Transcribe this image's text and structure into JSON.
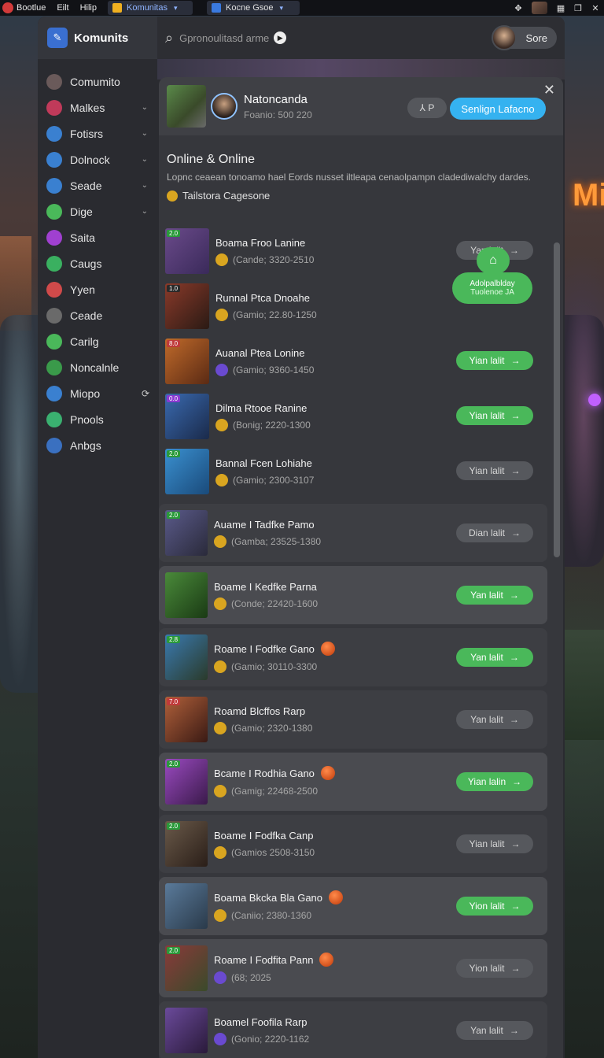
{
  "topbar": {
    "menu": [
      "Bootlue",
      "Eilt",
      "Hilip"
    ],
    "tabs": [
      {
        "label": "Komunitas",
        "color": "#f0b020"
      },
      {
        "label": "Kocne Gsoe",
        "color": "#3a7ae0"
      }
    ],
    "icons": [
      "move-icon",
      "avatar",
      "grid-icon",
      "window-icon",
      "close-icon"
    ]
  },
  "sidebar": {
    "title": "Komunits",
    "items": [
      {
        "label": "Comumito",
        "icon": "avatar-icon",
        "color": "#6a5a5a",
        "chevron": false
      },
      {
        "label": "Malkes",
        "icon": "gem-icon",
        "color": "#c03a5a",
        "chevron": true
      },
      {
        "label": "Fotisrs",
        "icon": "sword-icon",
        "color": "#3a80d0",
        "chevron": true
      },
      {
        "label": "Dolnock",
        "icon": "globe-icon",
        "color": "#3a80d0",
        "chevron": true
      },
      {
        "label": "Seade",
        "icon": "grid-icon",
        "color": "#3a80d0",
        "chevron": true
      },
      {
        "label": "Dige",
        "icon": "pen-icon",
        "color": "#4ab85a",
        "chevron": true
      },
      {
        "label": "Saita",
        "icon": "star-icon",
        "color": "#a040d0",
        "chevron": false
      },
      {
        "label": "Caugs",
        "icon": "search-icon",
        "color": "#3ab060",
        "chevron": false
      },
      {
        "label": "Yyen",
        "icon": "target-icon",
        "color": "#d04a4a",
        "chevron": false
      },
      {
        "label": "Ceade",
        "icon": "plus-icon",
        "color": "#6a6a6a",
        "chevron": false
      },
      {
        "label": "Carilg",
        "icon": "gear-icon",
        "color": "#4ab85a",
        "chevron": false
      },
      {
        "label": "Noncalnle",
        "icon": "leaf-icon",
        "color": "#3a9a4a",
        "chevron": false
      },
      {
        "label": "Miopo",
        "icon": "rocket-icon",
        "color": "#3a80d0",
        "chevron": false,
        "trail": "⟳"
      },
      {
        "label": "Pnools",
        "icon": "monitor-icon",
        "color": "#3ab070",
        "chevron": false
      },
      {
        "label": "Anbgs",
        "icon": "wrench-icon",
        "color": "#3a70c0",
        "chevron": false
      }
    ]
  },
  "search": {
    "placeholder": "Gpronoulitasd arme",
    "user_label": "Sore"
  },
  "game": {
    "title": "Natoncanda",
    "sub": "Foanio: 500 220",
    "tool_label": "⅄ P",
    "primary_label": "Senlign Lafacno"
  },
  "section": {
    "title": "Online & Online",
    "desc": "Lopnc ceaean tonoamo hael Eords nusset iltleapa cenaolpampn cladediwalchy dardes.",
    "tag": "Tailstora Cagesone"
  },
  "list_a": [
    {
      "badge": "2.0",
      "badge_color": "#2a9a3a",
      "art": [
        "#6a4a8a",
        "#3a2a5a"
      ],
      "name": "Boama Froo Lanine",
      "meta": "(Cande; 3320-2510",
      "meta_icon": "coin",
      "action": "Yan lalit",
      "green": false
    },
    {
      "badge": "1.0",
      "badge_color": "#2a2a2a",
      "art": [
        "#8a3a2a",
        "#2a1a14"
      ],
      "name": "Runnal Ptca Dnoahe",
      "meta": "(Gamio; 22.80-1250",
      "meta_icon": "coin",
      "action": "",
      "green": false
    },
    {
      "badge": "8.0",
      "badge_color": "#c03a3a",
      "art": [
        "#c06a2a",
        "#5a2a14"
      ],
      "name": "Auanal Ptea Lonine",
      "meta": "(Gamio; 9360-1450",
      "meta_icon": "purple",
      "action": "Yian lalit",
      "green": true
    },
    {
      "badge": "0.0",
      "badge_color": "#8a3ad0",
      "art": [
        "#3a6ab0",
        "#1a2a4a"
      ],
      "name": "Dilma Rtooe Ranine",
      "meta": "(Bonig; 2220-1300",
      "meta_icon": "coin",
      "action": "Yian lalit",
      "green": true
    },
    {
      "badge": "2.0",
      "badge_color": "#2a9a3a",
      "art": [
        "#3a90d0",
        "#1a4a7a"
      ],
      "name": "Bannal Fcen Lohiahe",
      "meta": "(Gamio; 2300-3107",
      "meta_icon": "coin",
      "action": "Yian lalit",
      "green": false
    }
  ],
  "list_b": [
    {
      "badge": "2.0",
      "badge_color": "#2a9a3a",
      "art": [
        "#5a5a8a",
        "#2a2a3a"
      ],
      "name": "Auame I Tadfke Pamo",
      "meta": "(Gamba; 23525-1380",
      "meta_icon": "coin",
      "action": "Dian lalit",
      "green": false,
      "hi": false,
      "ball": false
    },
    {
      "badge": "",
      "badge_color": "#2a9a3a",
      "art": [
        "#4a8a3a",
        "#1a3a14"
      ],
      "name": "Boame I Kedfke Parna",
      "meta": "(Conde; 22420-1600",
      "meta_icon": "coin",
      "action": "Yan lalit",
      "green": true,
      "hi": true,
      "ball": false
    },
    {
      "badge": "2.8",
      "badge_color": "#2a9a3a",
      "art": [
        "#3a7ab0",
        "#2a3a2a"
      ],
      "name": "Roame I Fodfke Gano",
      "meta": "(Gamio; 30110-3300",
      "meta_icon": "coin",
      "action": "Yan lalit",
      "green": true,
      "hi": false,
      "ball": true
    },
    {
      "badge": "7.0",
      "badge_color": "#c03a3a",
      "art": [
        "#b0603a",
        "#3a1a14"
      ],
      "name": "Roamd Blcffos Rarp",
      "meta": "(Gamio; 2320-1380",
      "meta_icon": "coin",
      "action": "Yan lalit",
      "green": false,
      "hi": false,
      "ball": false
    },
    {
      "badge": "2.0",
      "badge_color": "#2a9a3a",
      "art": [
        "#9a4ac0",
        "#3a1a4a"
      ],
      "name": "Bcame I Rodhia Gano",
      "meta": "(Gamig; 22468-2500",
      "meta_icon": "coin",
      "action": "Yian lalin",
      "green": true,
      "hi": true,
      "ball": true
    },
    {
      "badge": "2.0",
      "badge_color": "#2a9a3a",
      "art": [
        "#6a5a4a",
        "#2a1e18"
      ],
      "name": "Boame I Fodfka Canp",
      "meta": "(Gamios 2508-3150",
      "meta_icon": "coin",
      "action": "Yian lalit",
      "green": false,
      "hi": false,
      "ball": false
    },
    {
      "badge": "",
      "badge_color": "#2a9a3a",
      "art": [
        "#5a7a9a",
        "#2a3a4a"
      ],
      "name": "Boama Bkcka Bla Gano",
      "meta": "(Caniio; 2380-1360",
      "meta_icon": "coin",
      "action": "Yion lalit",
      "green": true,
      "hi": true,
      "ball": true
    },
    {
      "badge": "2.0",
      "badge_color": "#2a9a3a",
      "art": [
        "#8a3a3a",
        "#3a4a2a"
      ],
      "name": "Roame I Fodfita Pann",
      "meta": "(68; 2025",
      "meta_icon": "purple",
      "action": "Yion lalit",
      "green": false,
      "hi": true,
      "ball": true
    },
    {
      "badge": "",
      "badge_color": "#2a9a3a",
      "art": [
        "#6a4a9a",
        "#2a1a3a"
      ],
      "name": "Boamel Foofila Rarp",
      "meta": "(Gonio; 2220-1162",
      "meta_icon": "purple",
      "action": "Yan lalit",
      "green": false,
      "hi": false,
      "ball": false
    }
  ],
  "chat": {
    "line1": "Adolpalblday",
    "line2": "Tuolenoe JA"
  },
  "colors": {
    "accent_blue": "#35b2f0",
    "accent_green": "#4ab85a",
    "panel": "#36373c"
  }
}
